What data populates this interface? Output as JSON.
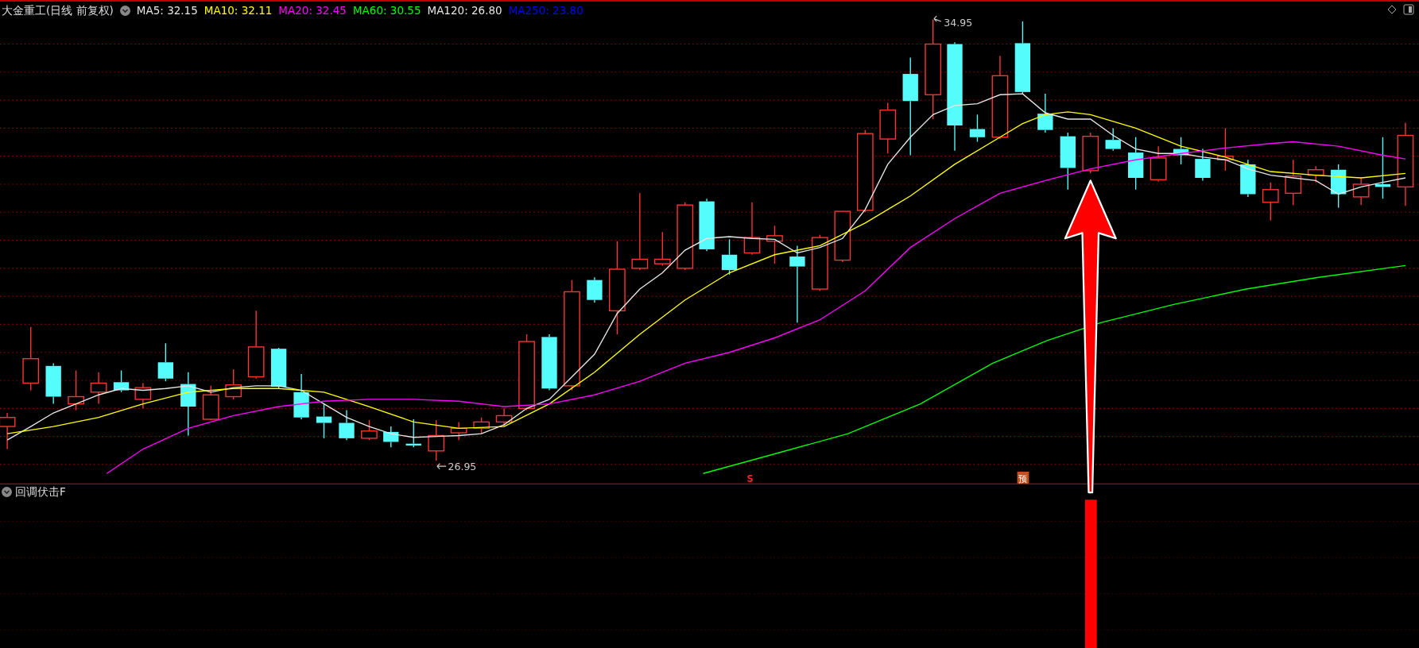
{
  "chart_header": {
    "title": "大金重工(日线 前复权)",
    "indicators": [
      {
        "label": "MA5: 32.15",
        "color": "#e6e6e6"
      },
      {
        "label": "MA10: 32.11",
        "color": "#ffff00"
      },
      {
        "label": "MA20: 32.45",
        "color": "#ff00ff"
      },
      {
        "label": "MA60: 30.55",
        "color": "#00ff00"
      },
      {
        "label": "MA120: 26.80",
        "color": "#e6e6e6"
      },
      {
        "label": "MA250: 23.80",
        "color": "#0000ff"
      }
    ]
  },
  "price_labels": {
    "high": "34.95",
    "low": "26.95"
  },
  "signals": [
    {
      "kind": "sell",
      "text": "S"
    },
    {
      "kind": "forecast",
      "text": "预"
    }
  ],
  "lower_panel": {
    "title": "回调伏击F"
  }
}
